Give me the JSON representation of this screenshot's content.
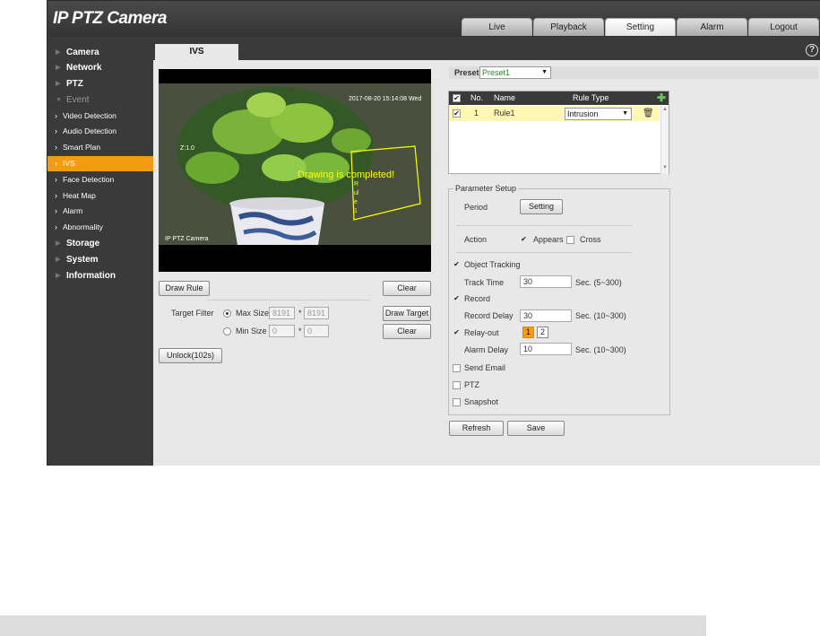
{
  "app": {
    "title": "IP PTZ Camera"
  },
  "nav": {
    "tabs": [
      "Live",
      "Playback",
      "Setting",
      "Alarm",
      "Logout"
    ],
    "active": "Setting"
  },
  "sidebar": {
    "items": [
      {
        "label": "Camera"
      },
      {
        "label": "Network"
      },
      {
        "label": "PTZ"
      },
      {
        "label": "Event"
      },
      {
        "label": "Video Detection"
      },
      {
        "label": "Audio Detection"
      },
      {
        "label": "Smart Plan"
      },
      {
        "label": "IVS"
      },
      {
        "label": "Face Detection"
      },
      {
        "label": "Heat Map"
      },
      {
        "label": "Alarm"
      },
      {
        "label": "Abnormality"
      },
      {
        "label": "Storage"
      },
      {
        "label": "System"
      },
      {
        "label": "Information"
      }
    ]
  },
  "page": {
    "tab": "IVS",
    "help_icon": "?"
  },
  "video": {
    "timestamp": "2017-08-20 15:14:08 Wed",
    "zoom": "Z:1.0",
    "status_message": "Drawing is completed!",
    "channel_label": "IP PTZ Camera",
    "rule_label": "Rule1"
  },
  "left_controls": {
    "draw_rule": "Draw Rule",
    "clear": "Clear",
    "target_filter_label": "Target Filter",
    "max_size_label": "Max Size",
    "max_w": "8191",
    "max_h": "8191",
    "times": "*",
    "draw_target": "Draw Target",
    "min_size_label": "Min Size",
    "min_w": "0",
    "min_h": "0",
    "clear2": "Clear",
    "unlock": "Unlock(102s)"
  },
  "preset": {
    "label": "Preset",
    "value": "Preset1"
  },
  "rules": {
    "headers": {
      "no": "No.",
      "name": "Name",
      "rule_type": "Rule Type"
    },
    "rows": [
      {
        "no": "1",
        "name": "Rule1",
        "type": "Intrusion"
      }
    ]
  },
  "params": {
    "legend": "Parameter Setup",
    "period_label": "Period",
    "setting_button": "Setting",
    "action_label": "Action",
    "appears_label": "Appears",
    "cross_label": "Cross",
    "object_tracking_label": "Object Tracking",
    "track_time_label": "Track Time",
    "track_time": "30",
    "track_time_unit": "Sec. (5~300)",
    "record_label": "Record",
    "record_delay_label": "Record Delay",
    "record_delay": "30",
    "record_delay_unit": "Sec. (10~300)",
    "relay_out_label": "Relay-out",
    "relay_1": "1",
    "relay_2": "2",
    "alarm_delay_label": "Alarm Delay",
    "alarm_delay": "10",
    "alarm_delay_unit": "Sec. (10~300)",
    "send_email_label": "Send Email",
    "ptz_label": "PTZ",
    "snapshot_label": "Snapshot"
  },
  "footer": {
    "refresh": "Refresh",
    "save": "Save"
  },
  "colors": {
    "accent": "#f39c12",
    "chrome": "#3a3a3a",
    "panel": "#e8e8e8",
    "overlay": "#ffff00"
  }
}
